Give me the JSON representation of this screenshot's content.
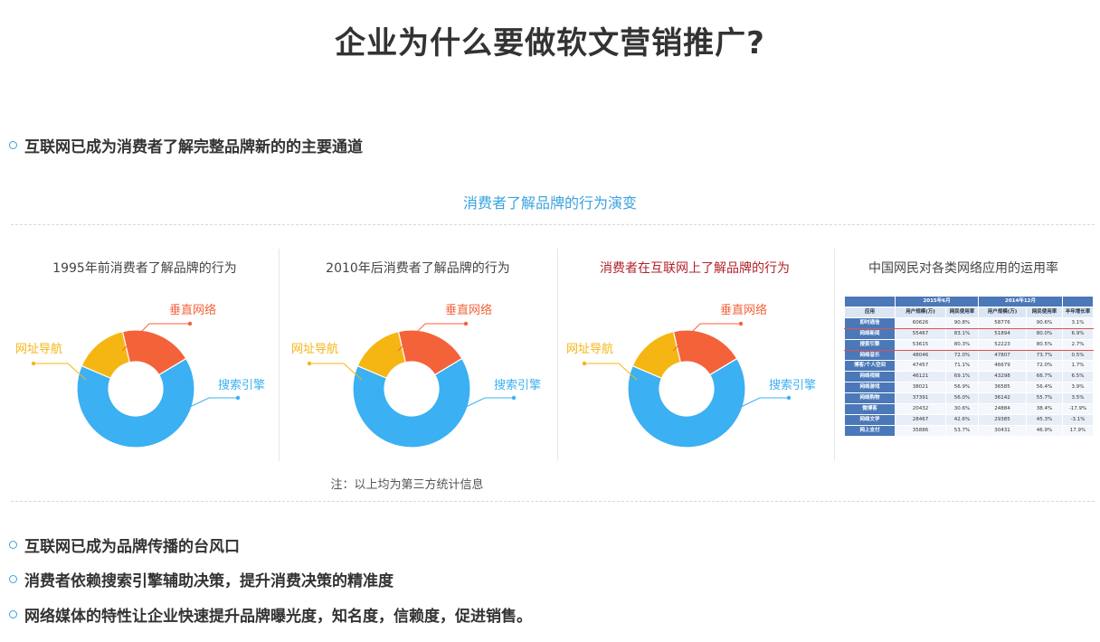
{
  "title": "企业为什么要做软文营销推广?",
  "bullets_top": [
    "互联网已成为消费者了解完整品牌新的的主要通道"
  ],
  "section_caption": "消费者了解品牌的行为演变",
  "panels": [
    {
      "title": "1995年前消费者了解品牌的行为"
    },
    {
      "title": "2010年后消费者了解品牌的行为"
    },
    {
      "title": "消费者在互联网上了解品牌的行为"
    },
    {
      "title": "中国网民对各类网络应用的运用率"
    }
  ],
  "chart_data": [
    {
      "type": "pie",
      "title": "1995年前消费者了解品牌的行为",
      "categories": [
        "垂直网络",
        "搜索引擎",
        "网址导航"
      ],
      "values": [
        20,
        65,
        15
      ]
    },
    {
      "type": "pie",
      "title": "2010年后消费者了解品牌的行为",
      "categories": [
        "垂直网络",
        "搜索引擎",
        "网址导航"
      ],
      "values": [
        20,
        65,
        15
      ]
    },
    {
      "type": "pie",
      "title": "消费者在互联网上了解品牌的行为",
      "categories": [
        "垂直网络",
        "搜索引擎",
        "网址导航"
      ],
      "values": [
        20,
        65,
        15
      ]
    },
    {
      "type": "table",
      "title": "中国网民对各类网络应用的运用率",
      "periods": [
        "2015年6月",
        "2014年12月"
      ],
      "header": [
        "应用",
        "用户规模(万)",
        "网民使用率",
        "用户规模(万)",
        "网民使用率",
        "半年增长率"
      ],
      "rows": [
        [
          "即时通信",
          "60626",
          "90.8%",
          "58776",
          "90.6%",
          "3.1%"
        ],
        [
          "网络新闻",
          "55467",
          "83.1%",
          "51894",
          "80.0%",
          "6.9%"
        ],
        [
          "搜索引擎",
          "53615",
          "80.3%",
          "52223",
          "80.5%",
          "2.7%"
        ],
        [
          "网络音乐",
          "48046",
          "72.0%",
          "47807",
          "73.7%",
          "0.5%"
        ],
        [
          "博客/个人空间",
          "47457",
          "71.1%",
          "46679",
          "72.0%",
          "1.7%"
        ],
        [
          "网络视频",
          "46121",
          "69.1%",
          "43298",
          "66.7%",
          "6.5%"
        ],
        [
          "网络游戏",
          "38021",
          "56.9%",
          "36585",
          "56.4%",
          "3.9%"
        ],
        [
          "网络购物",
          "37391",
          "56.0%",
          "36142",
          "55.7%",
          "3.5%"
        ],
        [
          "微博客",
          "20432",
          "30.6%",
          "24884",
          "38.4%",
          "-17.9%"
        ],
        [
          "网络文学",
          "28467",
          "42.6%",
          "29385",
          "45.3%",
          "-3.1%"
        ],
        [
          "网上支付",
          "35886",
          "53.7%",
          "30431",
          "46.9%",
          "17.9%"
        ]
      ]
    }
  ],
  "colors": {
    "vertical": "#f4623a",
    "search": "#3bb0f2",
    "nav": "#f5b614",
    "accent": "#3aa3e0"
  },
  "note": "注：以上均为第三方统计信息",
  "bullets_bottom": [
    "互联网已成为品牌传播的台风口",
    "消费者依赖搜索引擎辅助决策，提升消费决策的精准度",
    "网络媒体的特性让企业快速提升品牌曝光度，知名度，信赖度，促进销售。"
  ]
}
